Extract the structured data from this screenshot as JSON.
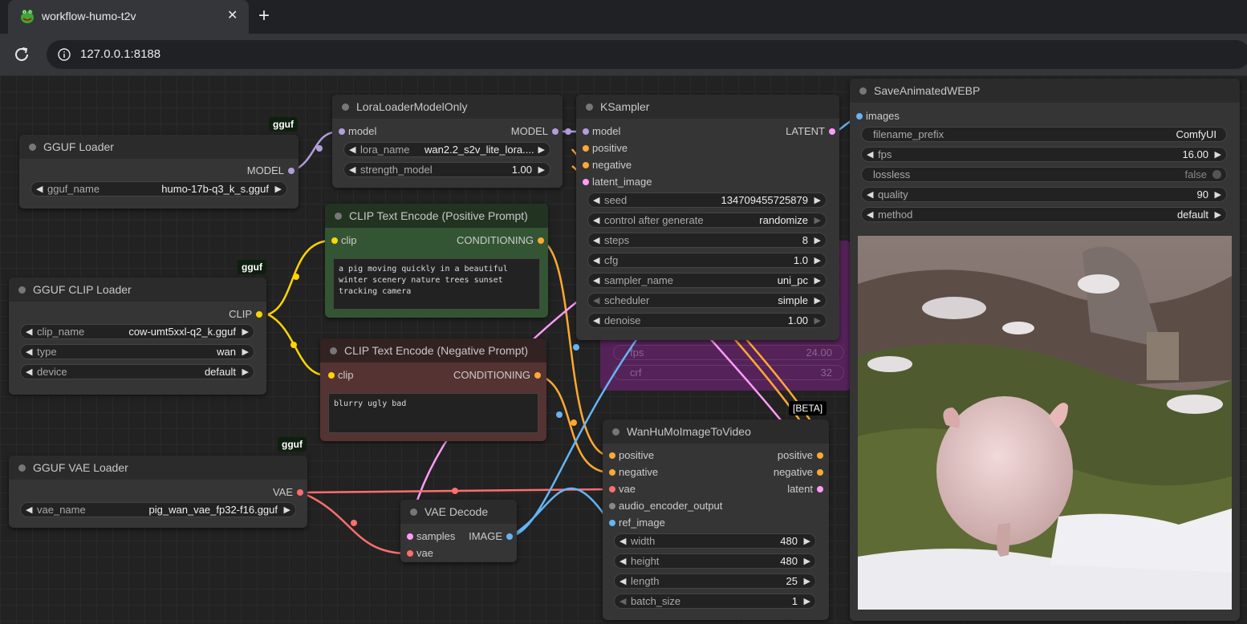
{
  "browser": {
    "tab_title": "workflow-humo-t2v",
    "close_glyph": "✕",
    "new_tab_glyph": "+",
    "url": "127.0.0.1:8188"
  },
  "badges": {
    "gguf": "gguf",
    "beta": "[BETA]"
  },
  "nodes": {
    "gguf_loader": {
      "title": "GGUF Loader",
      "output": "MODEL",
      "gguf_name_label": "gguf_name",
      "gguf_name_value": "humo-17b-q3_k_s.gguf"
    },
    "gguf_clip_loader": {
      "title": "GGUF CLIP Loader",
      "output": "CLIP",
      "clip_name_label": "clip_name",
      "clip_name_value": "cow-umt5xxl-q2_k.gguf",
      "type_label": "type",
      "type_value": "wan",
      "device_label": "device",
      "device_value": "default"
    },
    "gguf_vae_loader": {
      "title": "GGUF VAE Loader",
      "output": "VAE",
      "vae_name_label": "vae_name",
      "vae_name_value": "pig_wan_vae_fp32-f16.gguf"
    },
    "lora_loader": {
      "title": "LoraLoaderModelOnly",
      "input": "model",
      "output": "MODEL",
      "lora_name_label": "lora_name",
      "lora_name_value": "wan2.2_s2v_lite_lora....",
      "strength_label": "strength_model",
      "strength_value": "1.00"
    },
    "clip_pos": {
      "title": "CLIP Text Encode (Positive Prompt)",
      "input": "clip",
      "output": "CONDITIONING",
      "text": "a pig moving quickly in a beautiful winter scenery nature trees sunset tracking camera"
    },
    "clip_neg": {
      "title": "CLIP Text Encode (Negative Prompt)",
      "input": "clip",
      "output": "CONDITIONING",
      "text": "blurry ugly bad"
    },
    "ksampler": {
      "title": "KSampler",
      "inputs": [
        "model",
        "positive",
        "negative",
        "latent_image"
      ],
      "output": "LATENT",
      "widgets": [
        {
          "label": "seed",
          "value": "134709455725879"
        },
        {
          "label": "control after generate",
          "value": "randomize"
        },
        {
          "label": "steps",
          "value": "8"
        },
        {
          "label": "cfg",
          "value": "1.0"
        },
        {
          "label": "sampler_name",
          "value": "uni_pc"
        },
        {
          "label": "scheduler",
          "value": "simple"
        },
        {
          "label": "denoise",
          "value": "1.00"
        }
      ]
    },
    "hidden_node": {
      "fps_label": "fps",
      "fps_value": "24.00",
      "crf_label": "crf",
      "crf_value": "32"
    },
    "humo": {
      "title": "WanHuMoImageToVideo",
      "inputs": [
        "positive",
        "negative",
        "vae",
        "audio_encoder_output",
        "ref_image"
      ],
      "outputs": [
        "positive",
        "negative",
        "latent"
      ],
      "widgets": [
        {
          "label": "width",
          "value": "480"
        },
        {
          "label": "height",
          "value": "480"
        },
        {
          "label": "length",
          "value": "25"
        },
        {
          "label": "batch_size",
          "value": "1"
        }
      ]
    },
    "vae_decode": {
      "title": "VAE Decode",
      "inputs": [
        "samples",
        "vae"
      ],
      "output": "IMAGE"
    },
    "save_webp": {
      "title": "SaveAnimatedWEBP",
      "input": "images",
      "filename_prefix_label": "filename_prefix",
      "filename_prefix_value": "ComfyUI",
      "fps_label": "fps",
      "fps_value": "16.00",
      "lossless_label": "lossless",
      "lossless_value": "false",
      "quality_label": "quality",
      "quality_value": "90",
      "method_label": "method",
      "method_value": "default"
    }
  },
  "colors": {
    "model": "#b39ddb",
    "clip": "#ffd500",
    "conditioning": "#ffa931",
    "vae": "#ff6e6e",
    "latent": "#ff9cf9",
    "image": "#64b5f6"
  }
}
